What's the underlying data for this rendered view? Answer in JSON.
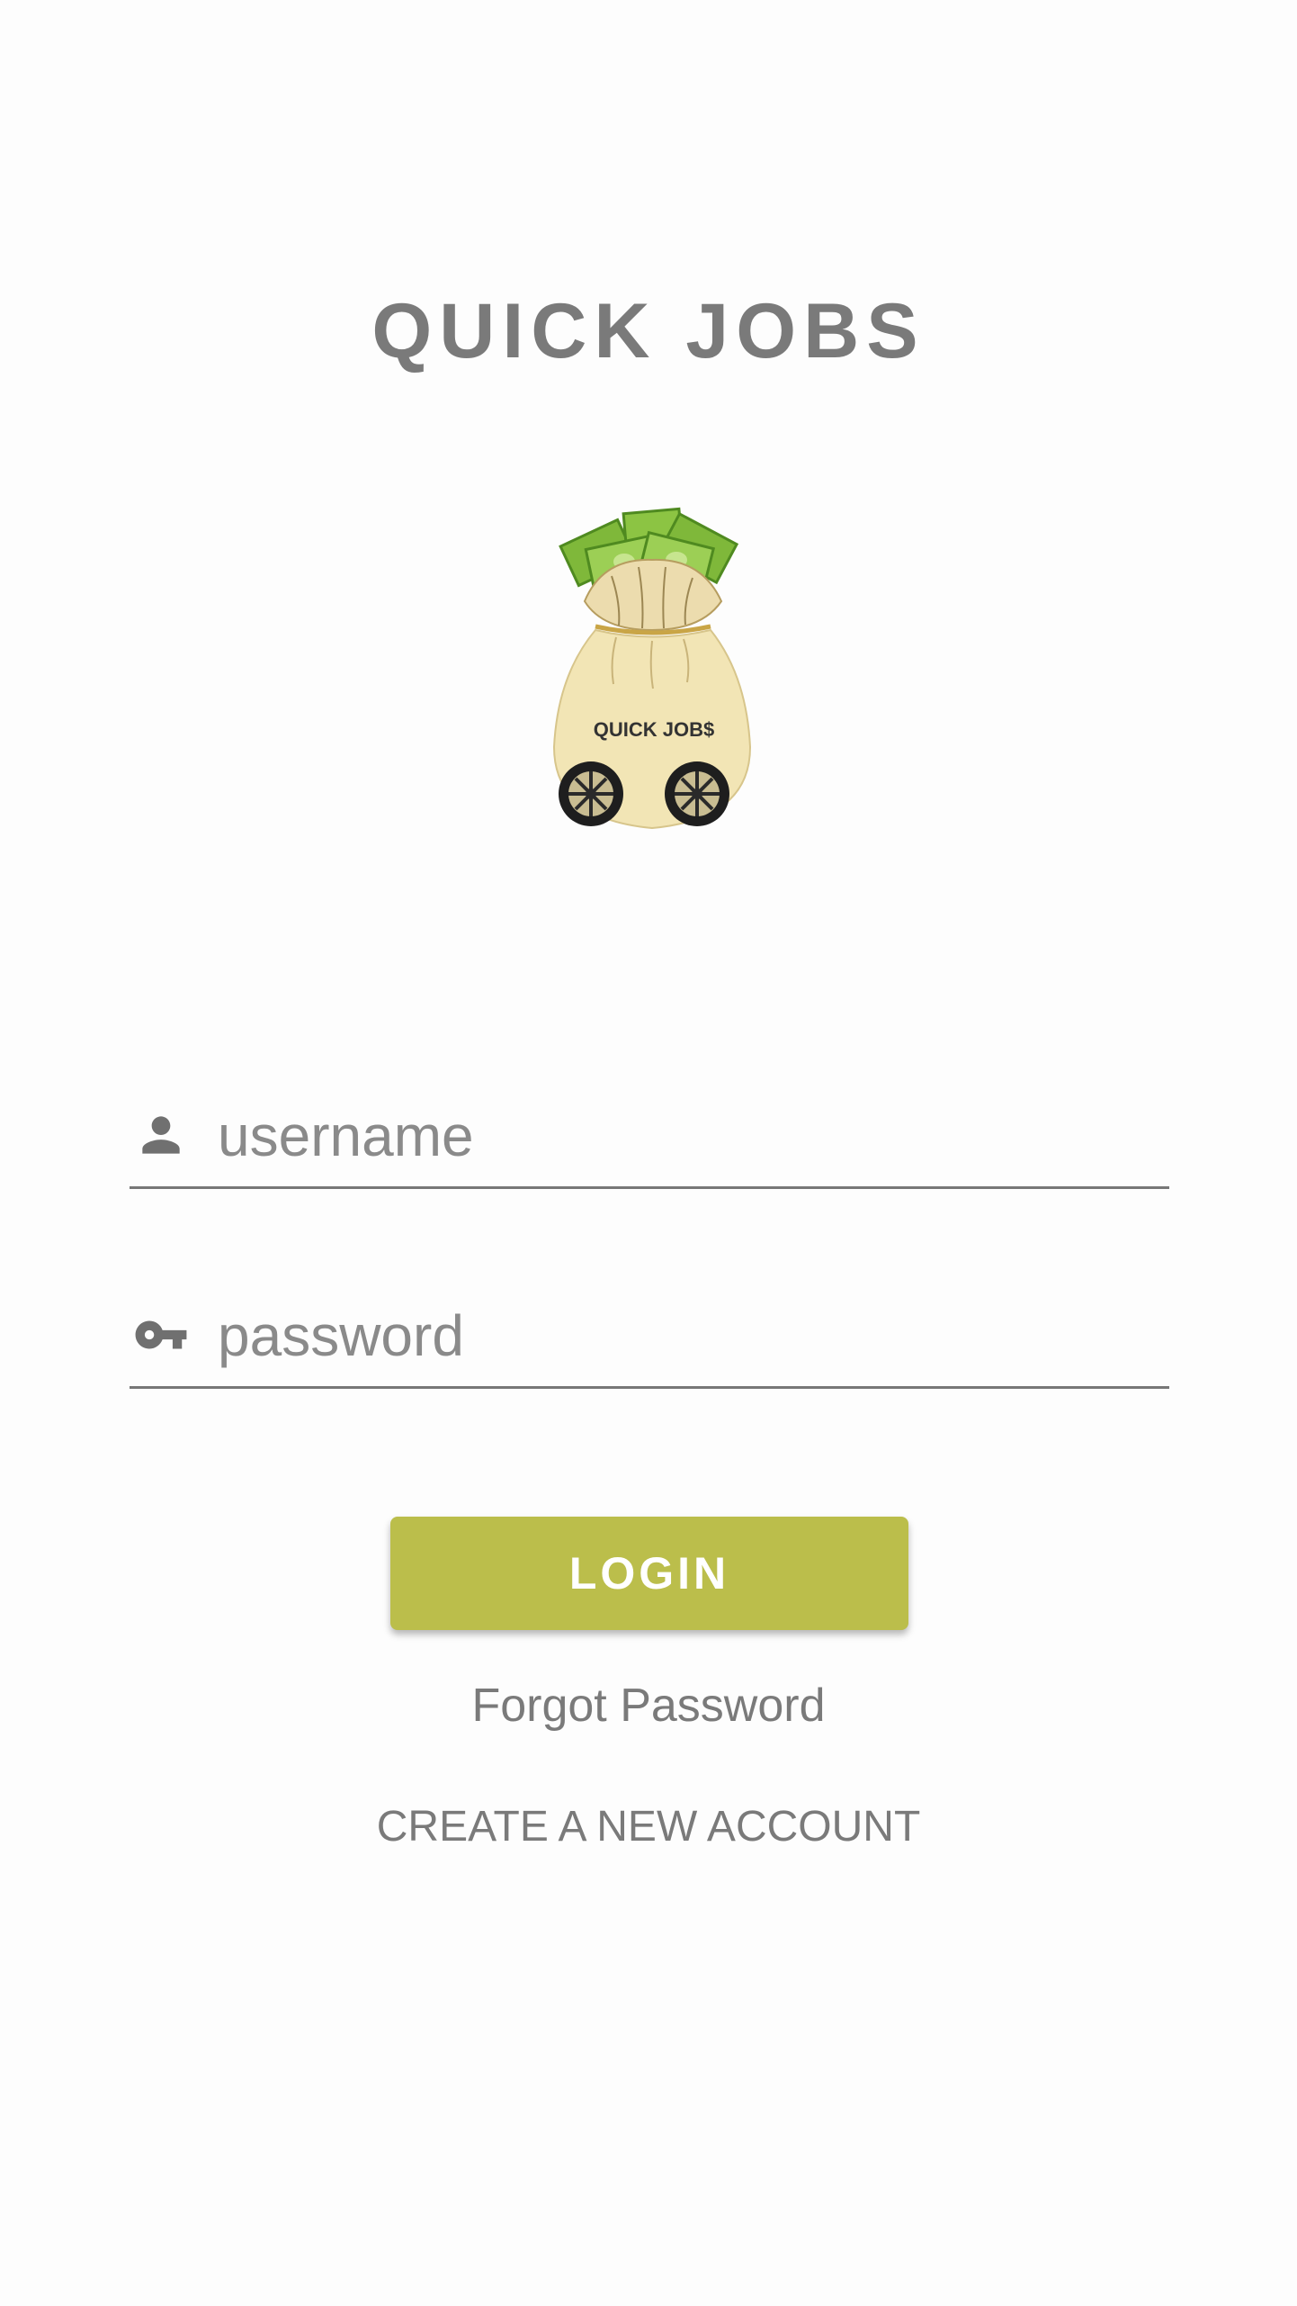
{
  "header": {
    "title": "QUICK JOBS"
  },
  "logo": {
    "icon": "money-bag-cart-logo",
    "text": "QUICK JOB$"
  },
  "form": {
    "username": {
      "icon": "person-icon",
      "placeholder": "username",
      "value": ""
    },
    "password": {
      "icon": "key-icon",
      "placeholder": "password",
      "value": ""
    },
    "login_label": "LOGIN",
    "forgot_label": "Forgot Password",
    "create_label": "CREATE A NEW ACCOUNT"
  },
  "colors": {
    "accent": "#bbbe4b",
    "text_gray": "#7a7a7a",
    "background": "#fdfdfd"
  }
}
